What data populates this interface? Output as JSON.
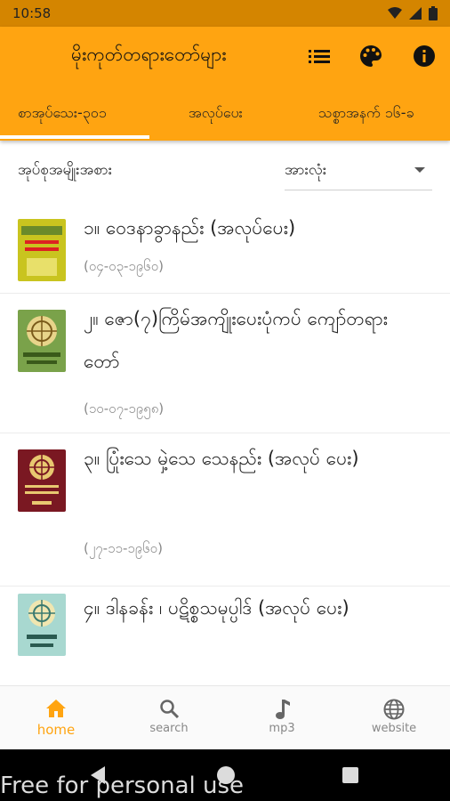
{
  "status_bar": {
    "time": "10:58"
  },
  "app_bar": {
    "title": "မိုးကုတ်တရားတော်များ"
  },
  "tabs": [
    {
      "label": "စာအုပ်သေး-၃၀၁"
    },
    {
      "label": "အလုပ်ပေး"
    },
    {
      "label": "သစ္စာအနက် ၁၆-ခ"
    }
  ],
  "filter": {
    "label": "အုပ်စုအမျိုးအစား",
    "selected": "အားလုံး"
  },
  "books": [
    {
      "title": "၁။ ဝေဒနာခွာနည်း (အလုပ်ပေး)",
      "date": "(၀၄-၀၃-၁၉၆၀)"
    },
    {
      "title": "၂။ ဇော(၇)ကြိမ်အကျိုးပေးပုံကပ် ကျော်တရားတော်",
      "date": "(၁၀-၀၇-၁၉၅၈)"
    },
    {
      "title": "၃။ ပြုံးသေ မှဲ့သေ သေနည်း (အလုပ် ပေး)",
      "date": "(၂၇-၁၁-၁၉၆၀)"
    },
    {
      "title": "၄။ ဒါနခန်း ၊ ပဋိစ္စသမုပ္ပါဒ် (အလုပ် ပေး)",
      "date": ""
    }
  ],
  "bottom_nav": [
    {
      "label": "home",
      "icon": "home-icon"
    },
    {
      "label": "search",
      "icon": "search-icon"
    },
    {
      "label": "mp3",
      "icon": "music-note-icon"
    },
    {
      "label": "website",
      "icon": "globe-icon"
    }
  ],
  "watermark": "Free for personal use",
  "colors": {
    "accent": "#ffa411",
    "status_bar": "#d48500"
  }
}
